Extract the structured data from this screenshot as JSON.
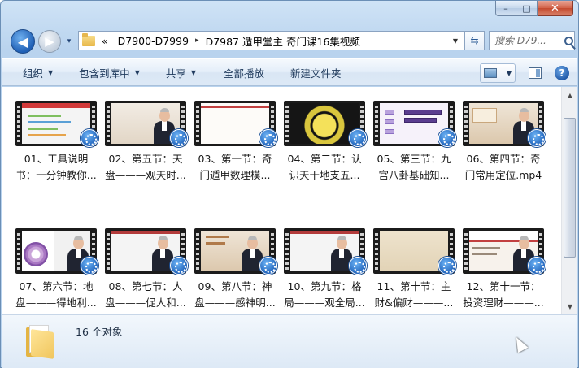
{
  "window": {
    "caption_buttons": {
      "minimize": "–",
      "maximize": "□",
      "close": "✕"
    }
  },
  "navigation": {
    "back_glyph": "◀",
    "forward_glyph": "▶",
    "history_glyph": "▾",
    "address_prefix": "«",
    "breadcrumb": [
      "D7900-D7999",
      "D7987 遁甲堂主 奇门课16集视频"
    ],
    "breadcrumb_separator": "▸",
    "dropdown_glyph": "▼",
    "refresh_glyph": "⇆",
    "search_placeholder": "搜索 D79..."
  },
  "toolbar": {
    "items": [
      {
        "label": "组织",
        "has_menu": true
      },
      {
        "label": "包含到库中",
        "has_menu": true
      },
      {
        "label": "共享",
        "has_menu": true
      },
      {
        "label": "全部播放",
        "has_menu": false
      },
      {
        "label": "新建文件夹",
        "has_menu": false
      }
    ],
    "menu_caret": "▼",
    "help_glyph": "?"
  },
  "files": [
    {
      "line1": "01、工具说明",
      "line2": "书：一分钟教你...",
      "icon": "video-file-icon"
    },
    {
      "line1": "02、第五节：天",
      "line2": "盘———观天时...",
      "icon": "video-file-icon"
    },
    {
      "line1": "03、第一节：奇",
      "line2": "门遁甲数理模...",
      "icon": "video-file-icon"
    },
    {
      "line1": "04、第二节：认",
      "line2": "识天干地支五...",
      "icon": "video-file-icon"
    },
    {
      "line1": "05、第三节：九",
      "line2": "宫八卦基础知...",
      "icon": "video-file-icon"
    },
    {
      "line1": "06、第四节：奇",
      "line2": "门常用定位.mp4",
      "icon": "video-file-icon"
    },
    {
      "line1": "07、第六节：地",
      "line2": "盘———得地利...",
      "icon": "video-file-icon"
    },
    {
      "line1": "08、第七节：人",
      "line2": "盘———促人和...",
      "icon": "video-file-icon"
    },
    {
      "line1": "09、第八节：神",
      "line2": "盘———感神明...",
      "icon": "video-file-icon"
    },
    {
      "line1": "10、第九节：格",
      "line2": "局———观全局...",
      "icon": "video-file-icon"
    },
    {
      "line1": "11、第十节：主",
      "line2": "财&偏财———...",
      "icon": "video-file-icon"
    },
    {
      "line1": "12、第十一节：",
      "line2": "投资理财———...",
      "icon": "video-file-icon"
    }
  ],
  "scrollbar": {
    "up_glyph": "▲",
    "down_glyph": "▼"
  },
  "status": {
    "count_text": "16 个对象"
  },
  "colors": {
    "accent": "#1f5fb5",
    "close_button": "#c44a2f",
    "toolbar_text": "#1e395b"
  }
}
